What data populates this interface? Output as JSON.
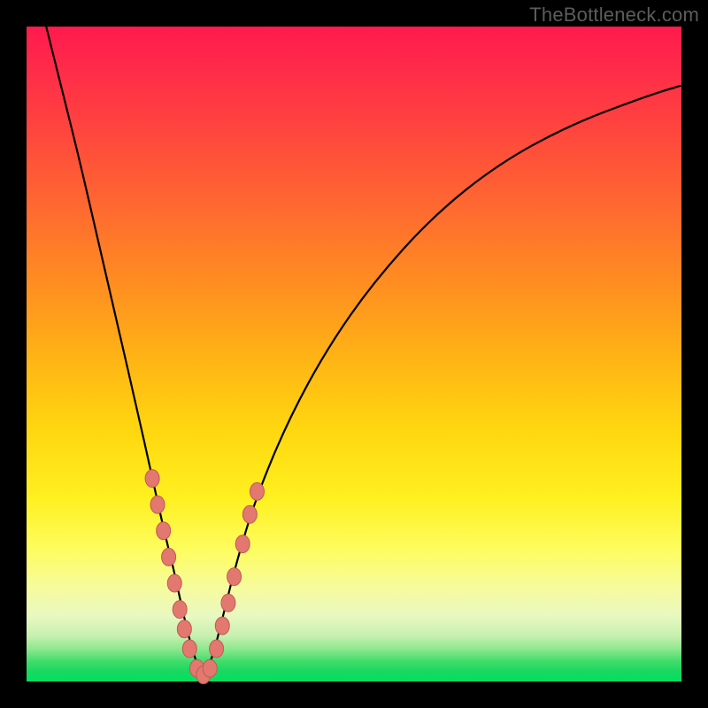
{
  "watermark": "TheBottleneck.com",
  "colors": {
    "frame": "#000000",
    "curve": "#000000",
    "bead_fill": "#e2786f",
    "bead_stroke": "#c15a53",
    "gradient_top": "#ff1a4d",
    "gradient_bottom": "#00e060"
  },
  "chart_data": {
    "type": "line",
    "title": "",
    "xlabel": "",
    "ylabel": "",
    "xlim": [
      0,
      100
    ],
    "ylim": [
      0,
      100
    ],
    "note": "V-shaped bottleneck curve with minimum near x≈27. Axis units are abstract (percent of range). Colored background is a vertical gradient from red (top) through yellow to green (bottom). Pink beads lie on the curve near the minimum.",
    "series": [
      {
        "name": "bottleneck-curve",
        "x": [
          3,
          5,
          8,
          11,
          14,
          17,
          19,
          21,
          22.5,
          24,
          25.5,
          27,
          28.5,
          30,
          32,
          35,
          40,
          46,
          53,
          62,
          72,
          83,
          95,
          100
        ],
        "y": [
          100,
          92,
          80,
          67,
          54,
          41,
          32,
          23,
          17,
          10,
          4,
          0.5,
          4,
          10,
          18,
          28,
          40,
          51,
          61,
          71,
          79,
          85,
          89.5,
          91
        ]
      }
    ],
    "beads": {
      "name": "beads",
      "note": "Pink oval markers clustered on both flanks of the V near y ≈ 7–33.",
      "x": [
        19.2,
        20.0,
        20.9,
        21.7,
        22.6,
        23.4,
        24.1,
        24.9,
        26.0,
        27.0,
        28.0,
        29.0,
        29.9,
        30.8,
        31.7,
        33.0,
        34.1,
        35.2
      ],
      "y": [
        31.0,
        27.0,
        23.0,
        19.0,
        15.0,
        11.0,
        8.0,
        5.0,
        2.0,
        1.0,
        2.0,
        5.0,
        8.5,
        12.0,
        16.0,
        21.0,
        25.5,
        29.0
      ]
    }
  }
}
